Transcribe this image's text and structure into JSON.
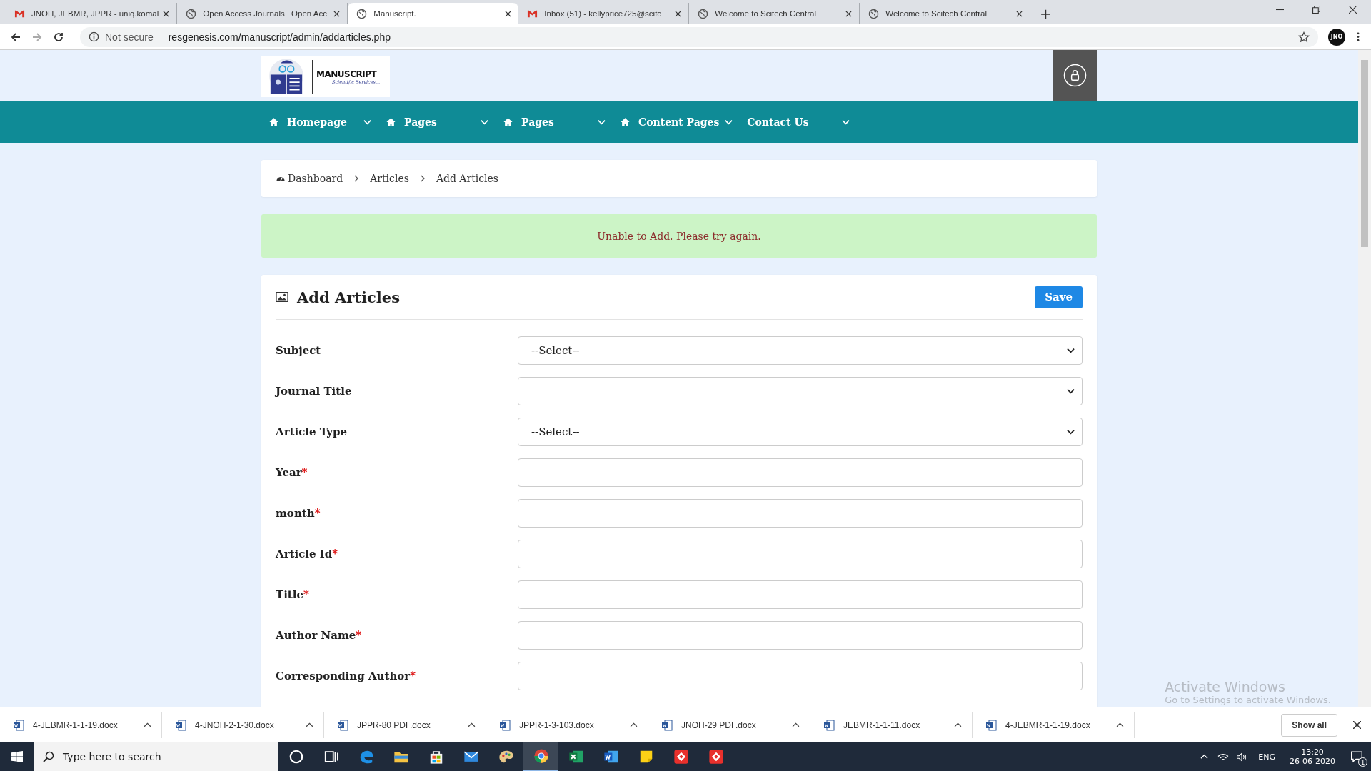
{
  "browser": {
    "tabs": [
      {
        "title": "JNOH, JEBMR, JPPR - uniq.komal",
        "kind": "mail",
        "selected": false
      },
      {
        "title": "Open Access Journals | Open Acc",
        "kind": "site",
        "selected": false
      },
      {
        "title": "Manuscript.",
        "kind": "site",
        "selected": true
      },
      {
        "title": "Inbox (51) - kellyprice725@scitc",
        "kind": "mail",
        "selected": false
      },
      {
        "title": "Welcome to Scitech Central",
        "kind": "site",
        "selected": false
      },
      {
        "title": "Welcome to Scitech Central",
        "kind": "site",
        "selected": false
      }
    ],
    "new_tab": "+",
    "security": "Not secure",
    "url": "resgenesis.com/manuscript/admin/addarticles.php",
    "profile": "JNO"
  },
  "site": {
    "logo": {
      "title": "MANUSCRIPT",
      "subtitle": "Scientific Services..."
    },
    "nav": [
      {
        "label": "Homepage",
        "has_icon": true
      },
      {
        "label": "Pages",
        "has_icon": true
      },
      {
        "label": "Pages",
        "has_icon": true
      },
      {
        "label": "Content Pages",
        "has_icon": true
      },
      {
        "label": "Contact Us",
        "has_icon": false
      }
    ],
    "breadcrumb": [
      "Dashboard",
      "Articles",
      "Add Articles"
    ],
    "alert": "Unable to Add. Please try again.",
    "form": {
      "title": "Add Articles",
      "save_button": "Save",
      "fields": [
        {
          "label": "Subject",
          "kind": "select",
          "value": "--Select--"
        },
        {
          "label": "Journal Title",
          "kind": "select"
        },
        {
          "label": "Article Type",
          "kind": "select",
          "value": "--Select--"
        },
        {
          "label": "Year",
          "required_mark": "*",
          "kind": "text"
        },
        {
          "label": "month",
          "required_mark": "*",
          "kind": "text"
        },
        {
          "label": "Article Id",
          "required_mark": "*",
          "kind": "text"
        },
        {
          "label": "Title",
          "required_mark": "*",
          "kind": "text"
        },
        {
          "label": "Author Name",
          "required_mark": "*",
          "kind": "text"
        },
        {
          "label": "Corresponding Author",
          "required_mark": "*",
          "kind": "text"
        }
      ]
    }
  },
  "os_notice": {
    "title": "Activate Windows",
    "text": "Go to Settings to activate Windows."
  },
  "downloads": {
    "files": [
      "4-JEBMR-1-1-19.docx",
      "4-JNOH-2-1-30.docx",
      "JPPR-80 PDF.docx",
      "JPPR-1-3-103.docx",
      "JNOH-29 PDF.docx",
      "JEBMR-1-1-11.docx",
      "4-JEBMR-1-1-19.docx"
    ],
    "show_all": "Show all"
  },
  "taskbar": {
    "search_placeholder": "Type here to search",
    "apps": [
      {
        "selected": false
      },
      {
        "selected": false
      },
      {
        "selected": false
      },
      {
        "selected": false
      },
      {
        "selected": false
      },
      {
        "selected": false
      },
      {
        "selected": false
      },
      {
        "selected": true
      },
      {
        "selected": false
      },
      {
        "selected": false
      },
      {
        "selected": false
      },
      {
        "selected": false
      },
      {
        "selected": false
      }
    ],
    "language": "ENG",
    "time": "13:20",
    "date": "26-06-2020",
    "notifications": "1"
  }
}
